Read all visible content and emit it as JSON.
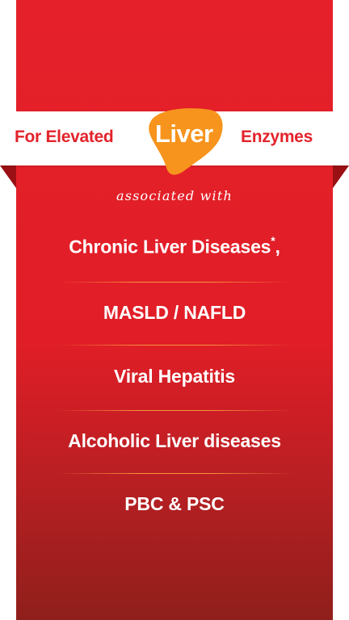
{
  "banner": {
    "prefix": "For Elevated",
    "highlight": "Liver",
    "suffix": "Enzymes",
    "highlight_color": "#f7941d",
    "text_color": "#e3232b",
    "background_color": "#e11e27"
  },
  "subtitle": "associated with",
  "conditions": [
    {
      "label": "Chronic Liver Diseases",
      "mark": "*",
      "trail": ","
    },
    {
      "label": "MASLD / NAFLD"
    },
    {
      "label": "Viral Hepatitis"
    },
    {
      "label": "Alcoholic Liver diseases"
    },
    {
      "label": "PBC & PSC"
    }
  ]
}
